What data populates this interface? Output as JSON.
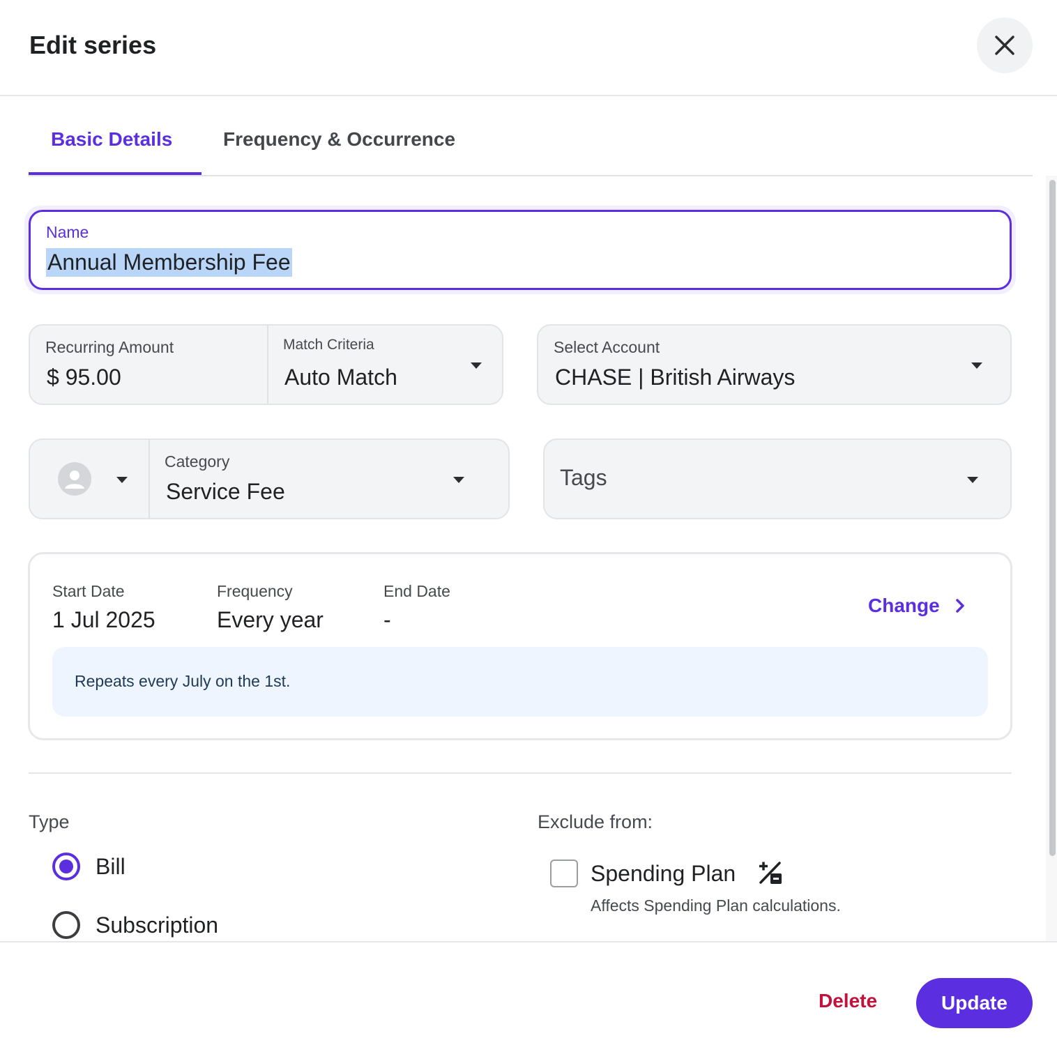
{
  "dialog": {
    "title": "Edit series"
  },
  "tabs": [
    {
      "label": "Basic Details",
      "active": true
    },
    {
      "label": "Frequency & Occurrence",
      "active": false
    }
  ],
  "name": {
    "label": "Name",
    "value": "Annual Membership Fee"
  },
  "recurring_amount": {
    "label": "Recurring Amount",
    "value": "$ 95.00"
  },
  "match_criteria": {
    "label": "Match Criteria",
    "value": "Auto Match"
  },
  "account": {
    "label": "Select Account",
    "value": "CHASE | British Airways"
  },
  "category": {
    "label": "Category",
    "value": "Service Fee",
    "icon": "user-avatar-icon"
  },
  "tags": {
    "placeholder": "Tags"
  },
  "schedule": {
    "start_label": "Start Date",
    "start_value": "1 Jul 2025",
    "frequency_label": "Frequency",
    "frequency_value": "Every year",
    "end_label": "End Date",
    "end_value": "-",
    "change_label": "Change",
    "repeat_text": "Repeats every July on the 1st."
  },
  "type": {
    "label": "Type",
    "options": [
      {
        "label": "Bill",
        "selected": true
      },
      {
        "label": "Subscription",
        "selected": false
      }
    ]
  },
  "exclude": {
    "label": "Exclude from:",
    "options": [
      {
        "label": "Spending Plan",
        "description": "Affects Spending Plan calculations.",
        "checked": false,
        "icon": "plus-minus-icon"
      }
    ]
  },
  "footer": {
    "delete_label": "Delete",
    "update_label": "Update"
  },
  "colors": {
    "accent": "#5b2ee0",
    "danger": "#c2113a",
    "selection": "#b9d6f8"
  }
}
